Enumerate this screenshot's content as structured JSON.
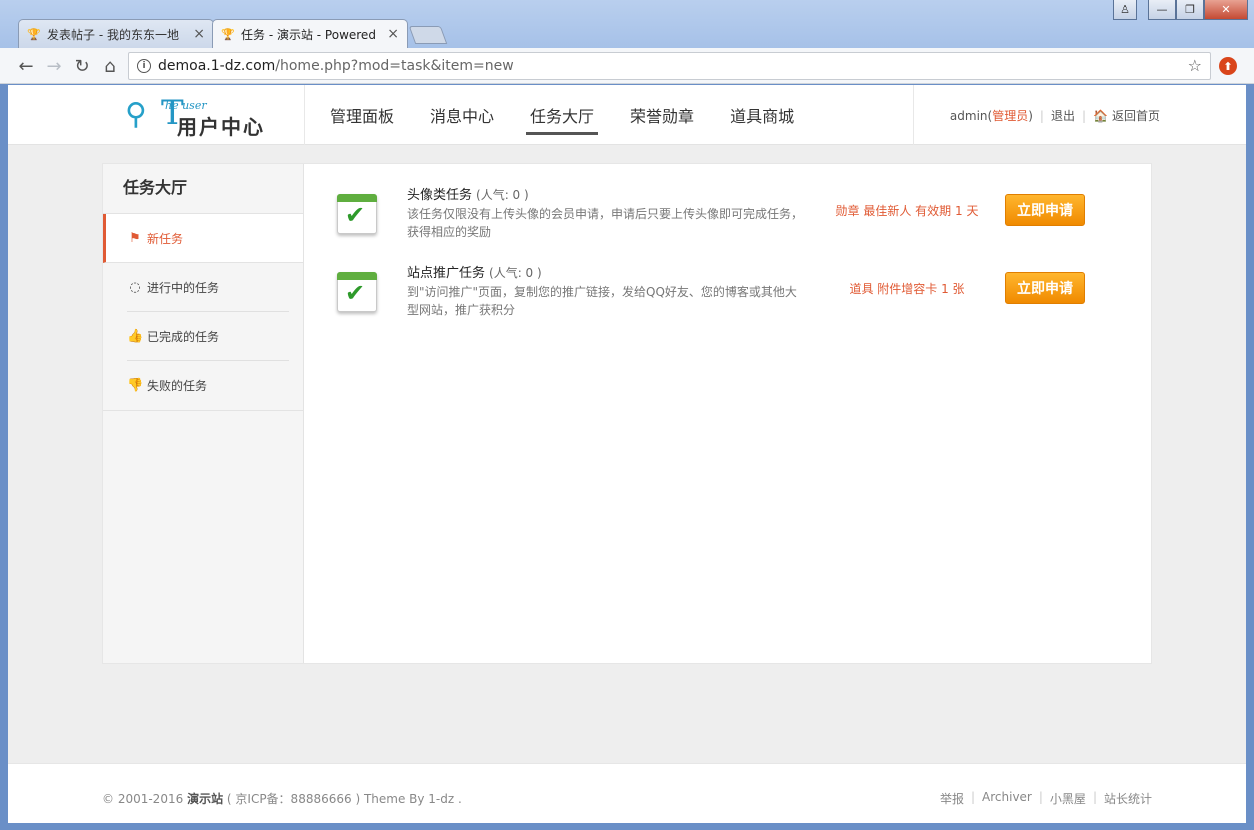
{
  "browser": {
    "tabs": [
      {
        "label": "发表帖子 - 我的东东一地",
        "close": "×"
      },
      {
        "label": "任务 - 演示站 - Powered",
        "close": "×"
      }
    ],
    "window_controls": {
      "user": "♙",
      "minimize": "—",
      "maximize": "❐",
      "close": "✕"
    },
    "url_host": "demoa.1-dz.com",
    "url_path": "/home.php?mod=task&item=new"
  },
  "header": {
    "logo_en": "he user",
    "logo_cn": "用户中心",
    "nav": [
      "管理面板",
      "消息中心",
      "任务大厅",
      "荣誉勋章",
      "道具商城"
    ],
    "current_nav": "任务大厅",
    "user": {
      "name": "admin",
      "role_open": " ( ",
      "role": "管理员",
      "role_close": " )",
      "logout": "退出",
      "home": "返回首页"
    }
  },
  "sidebar": {
    "title": "任务大厅",
    "items": [
      {
        "label": "新任务",
        "icon": "flag-icon",
        "active": true
      },
      {
        "label": "进行中的任务",
        "icon": "spinner-icon"
      },
      {
        "label": "已完成的任务",
        "icon": "thumbs-up-icon"
      },
      {
        "label": "失败的任务",
        "icon": "thumbs-down-icon"
      }
    ]
  },
  "tasks": [
    {
      "name": "头像类任务",
      "popularity": "(人气: 0 )",
      "desc": "该任务仅限没有上传头像的会员申请，申请后只要上传头像即可完成任务，获得相应的奖励",
      "reward": "勋章 最佳新人 有效期 1 天",
      "button": "立即申请"
    },
    {
      "name": "站点推广任务",
      "popularity": "(人气: 0 )",
      "desc": "到\"访问推广\"页面，复制您的推广链接，发给QQ好友、您的博客或其他大型网站，推广获积分",
      "reward": "道具 附件增容卡 1 张",
      "button": "立即申请"
    }
  ],
  "footer": {
    "copyright": "© 2001-2016",
    "site": "演示站",
    "icp": "( 京ICP备：88886666 ) Theme By 1-dz .",
    "links": [
      "举报",
      "Archiver",
      "小黑屋",
      "站长统计"
    ]
  },
  "colors": {
    "accent": "#e05a34",
    "button": "#f49a0a",
    "logo": "#2496c4"
  }
}
